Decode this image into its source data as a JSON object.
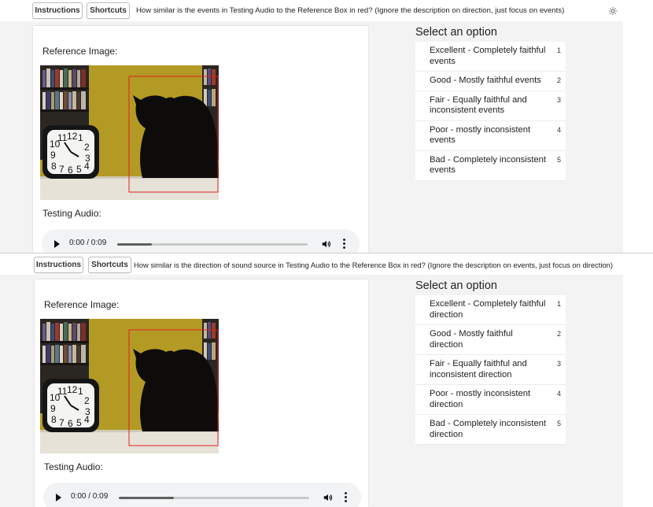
{
  "panels": [
    {
      "instructions_label": "Instructions",
      "shortcuts_label": "Shortcuts",
      "question": "How similar is the events in Testing Audio to the Reference Box in red? (Ignore the description on direction, just focus on events)",
      "settings_icon": "gear-icon",
      "reference_label": "Reference Image:",
      "testing_label": "Testing Audio:",
      "audio": {
        "time": "0:00 / 0:09",
        "progress": 0.18
      },
      "select_title": "Select an option",
      "options": [
        {
          "label": "Excellent - Completely faithful events",
          "key": "1"
        },
        {
          "label": "Good - Mostly faithful events",
          "key": "2"
        },
        {
          "label": "Fair - Equally faithful and inconsistent events",
          "key": "3"
        },
        {
          "label": "Poor - mostly inconsistent events",
          "key": "4"
        },
        {
          "label": "Bad - Completely inconsistent events",
          "key": "5"
        }
      ]
    },
    {
      "instructions_label": "Instructions",
      "shortcuts_label": "Shortcuts",
      "question": "How similar is the direction of sound source in Testing Audio to the Reference Box in red? (Ignore the description on events, just focus on direction)",
      "reference_label": "Reference Image:",
      "testing_label": "Testing Audio:",
      "audio": {
        "time": "0:00 / 0:09",
        "progress": 0.29
      },
      "select_title": "Select an option",
      "options": [
        {
          "label": "Excellent - Completely faithful direction",
          "key": "1"
        },
        {
          "label": "Good - Mostly faithful direction",
          "key": "2"
        },
        {
          "label": "Fair - Equally faithful and inconsistent direction",
          "key": "3"
        },
        {
          "label": "Poor - mostly inconsistent direction",
          "key": "4"
        },
        {
          "label": "Bad - Completely inconsistent direction",
          "key": "5"
        }
      ]
    }
  ],
  "colors": {
    "bounding_box": "#e02020",
    "background": "#f2f3f2",
    "wall": "#b39a24"
  }
}
